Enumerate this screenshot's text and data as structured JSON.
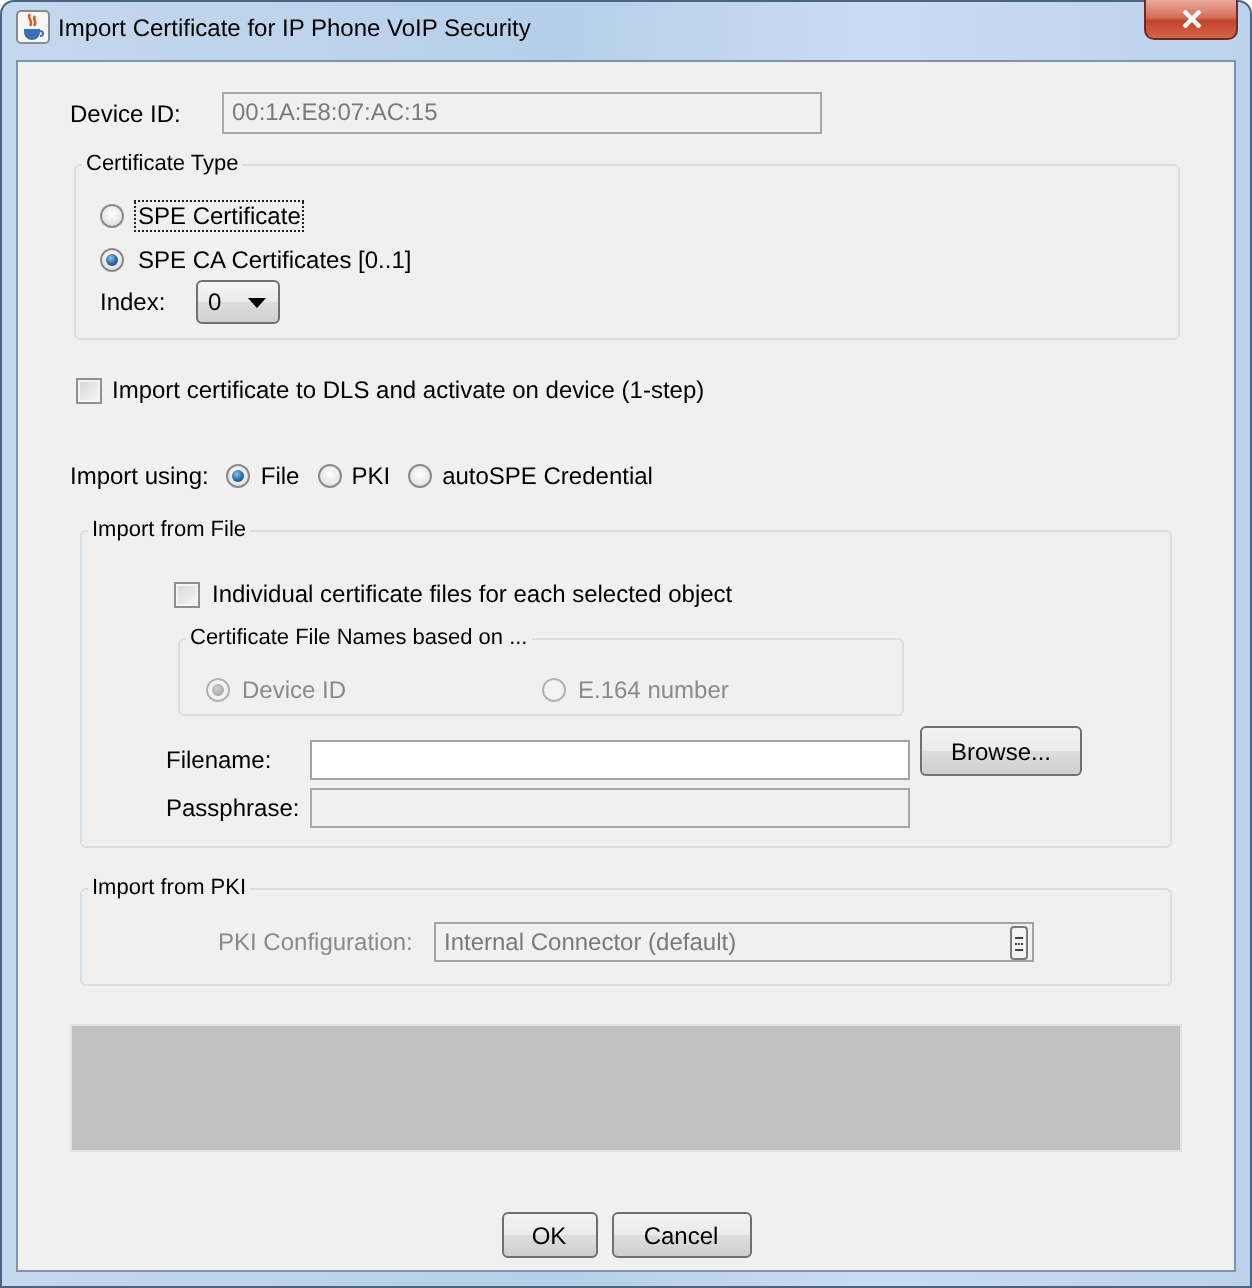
{
  "window": {
    "title": "Import Certificate for IP Phone VoIP Security"
  },
  "device_id": {
    "label": "Device ID:",
    "value": "00:1A:E8:07:AC:15",
    "disabled": true
  },
  "certificate_type": {
    "title": "Certificate Type",
    "options": [
      {
        "label": "SPE Certificate",
        "selected": false,
        "focused": true
      },
      {
        "label": "SPE CA Certificates [0..1]",
        "selected": true,
        "focused": false
      }
    ],
    "index": {
      "label": "Index:",
      "value": "0"
    }
  },
  "one_step": {
    "label": "Import certificate to DLS and activate on device (1-step)",
    "checked": false
  },
  "import_using": {
    "label": "Import using:",
    "options": [
      {
        "label": "File",
        "selected": true
      },
      {
        "label": "PKI",
        "selected": false
      },
      {
        "label": "autoSPE Credential",
        "selected": false
      }
    ]
  },
  "import_from_file": {
    "title": "Import from File",
    "individual_files": {
      "label": "Individual certificate files for each selected object",
      "checked": false
    },
    "file_names": {
      "title": "Certificate File Names based on ...",
      "disabled": true,
      "options": [
        {
          "label": "Device ID",
          "selected": true
        },
        {
          "label": "E.164 number",
          "selected": false
        }
      ]
    },
    "filename": {
      "label": "Filename:"
    },
    "browse_button": "Browse...",
    "passphrase": {
      "label": "Passphrase:",
      "disabled": true
    }
  },
  "import_from_pki": {
    "title": "Import from PKI",
    "disabled": true,
    "configuration": {
      "label": "PKI Configuration:",
      "value": "Internal Connector (default)"
    }
  },
  "buttons": [
    "OK",
    "Cancel"
  ]
}
